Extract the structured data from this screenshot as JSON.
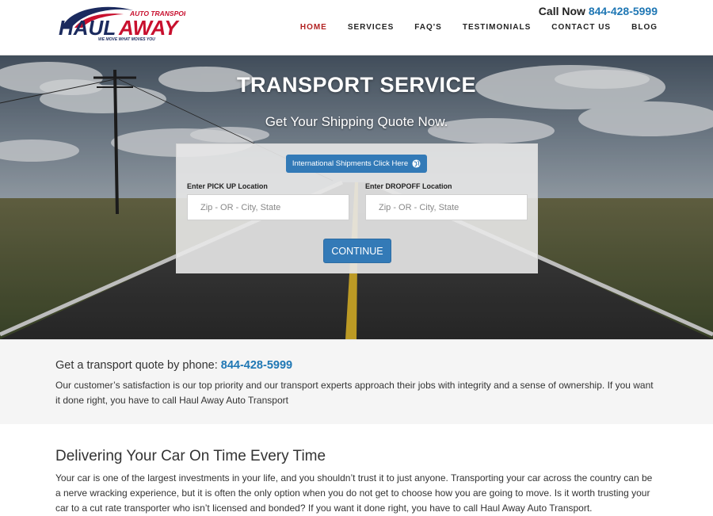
{
  "header": {
    "logo": {
      "top_text": "AUTO TRANSPORT",
      "main_left": "HAUL",
      "main_right": "AWAY",
      "tagline": "WE MOVE WHAT MOVES YOU"
    },
    "call_now_label": "Call Now",
    "call_now_number": "844-428-5999",
    "nav": [
      {
        "label": "HOME",
        "active": true
      },
      {
        "label": "SERVICES",
        "active": false
      },
      {
        "label": "FAQ'S",
        "active": false
      },
      {
        "label": "TESTIMONIALS",
        "active": false
      },
      {
        "label": "CONTACT US",
        "active": false
      },
      {
        "label": "BLOG",
        "active": false
      }
    ]
  },
  "hero": {
    "title": "TRANSPORT SERVICE",
    "subtitle": "Get Your Shipping Quote Now.",
    "intl_button": "International Shipments Click Here",
    "pickup_label": "Enter PICK UP Location",
    "pickup_placeholder": "Zip - OR - City, State",
    "dropoff_label": "Enter DROPOFF Location",
    "dropoff_placeholder": "Zip - OR - City, State",
    "continue_label": "CONTINUE"
  },
  "phone_section": {
    "heading": "Get a transport quote by phone:",
    "number": "844-428-5999",
    "text": "Our customer’s satisfaction is our top priority and our transport experts approach their jobs with integrity and a sense of ownership. If you want it done right, you have to call Haul Away Auto Transport"
  },
  "deliver_section": {
    "heading": "Delivering Your Car On Time Every Time",
    "text": "Your car is one of the largest investments in your life, and you shouldn’t trust it to just anyone. Transporting your car across the country can be a nerve wracking experience, but it is often the only option when you do not get to choose how you are going to move. Is it worth trusting your car to a cut rate transporter who isn’t licensed and bonded? If you want it done right, you have to call Haul Away Auto Transport."
  },
  "colors": {
    "brand_blue": "#337ab7",
    "link_blue": "#1f77b4",
    "nav_active": "#b22222",
    "logo_navy": "#1b2a5e",
    "logo_red": "#c8102e"
  }
}
